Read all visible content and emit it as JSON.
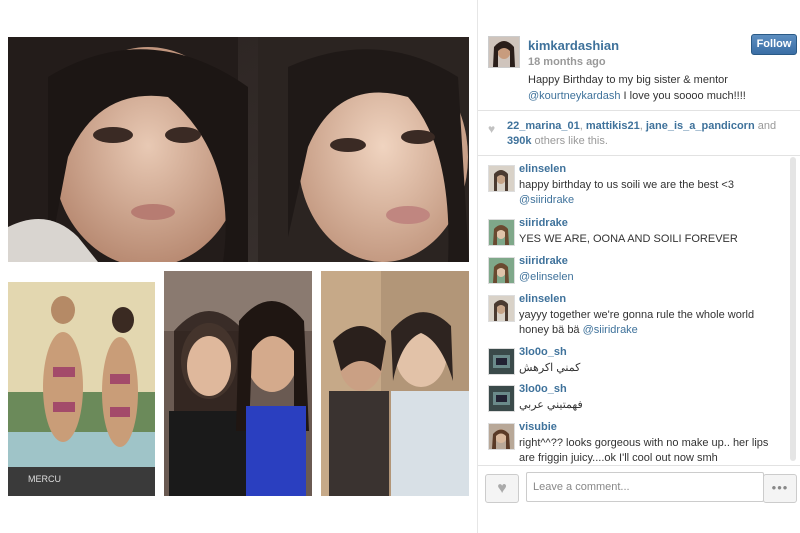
{
  "post": {
    "username": "kimkardashian",
    "time": "18 months ago",
    "caption_text": "Happy Birthday to my big sister & mentor",
    "caption_mention": "@kourtneykardash",
    "caption_suffix": " I love you soooo much!!!!",
    "follow_label": "Follow"
  },
  "likes": {
    "user1": "22_marina_01",
    "user2": "mattikis21",
    "user3": "jane_is_a_pandicorn",
    "and": "and",
    "others": "390k",
    "suffix": "others like this."
  },
  "comments": [
    {
      "user": "elinselen",
      "text": "happy birthday to us soili we are the best <3",
      "mention": "@siiridrake"
    },
    {
      "user": "siiridrake",
      "text": "YES WE ARE, OONA AND SOILI FOREVER",
      "mention": ""
    },
    {
      "user": "siiridrake",
      "text": "",
      "mention": "@elinselen"
    },
    {
      "user": "elinselen",
      "text": "yayyy together we're gonna rule the whole world honey bä bä",
      "mention": "@siiridrake"
    },
    {
      "user": "3lo0o_sh",
      "text": "كمني اكرهش",
      "mention": ""
    },
    {
      "user": "3lo0o_sh",
      "text": "فهمتيني عربي",
      "mention": ""
    },
    {
      "user": "visubie",
      "text": "right^^?? looks gorgeous with no make up.. her lips are friggin juicy....ok I'll cool out now smh",
      "mention": ""
    }
  ],
  "footer": {
    "comment_placeholder": "Leave a comment...",
    "more_label": "•••"
  },
  "icons": {
    "heart": "heart-icon",
    "more": "more-options-icon"
  },
  "colors": {
    "link": "#3f729b",
    "follow_button": "#3a6ea5"
  }
}
